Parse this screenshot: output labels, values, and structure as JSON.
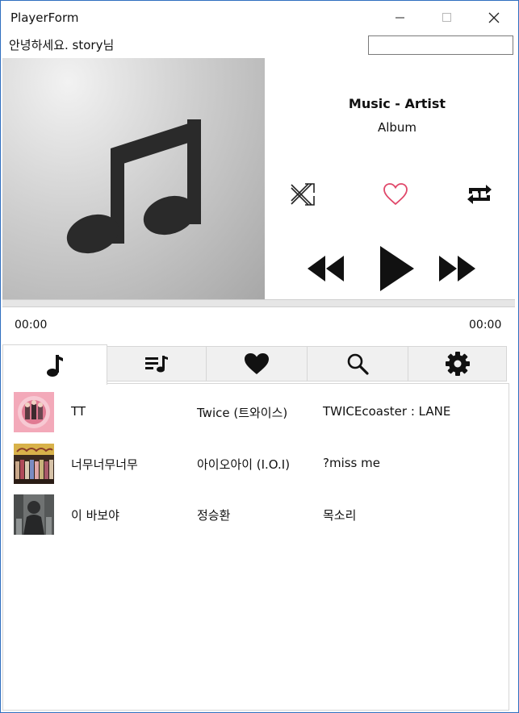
{
  "window": {
    "title": "PlayerForm"
  },
  "header": {
    "greeting": "안녕하세요. story님",
    "search_value": ""
  },
  "now_playing": {
    "title": "Music - Artist",
    "album": "Album"
  },
  "player": {
    "time_current": "00:00",
    "time_total": "00:00",
    "progress": 0
  },
  "tabs": [
    {
      "icon": "music-note-icon",
      "active": true
    },
    {
      "icon": "playlist-icon",
      "active": false
    },
    {
      "icon": "heart-icon",
      "active": false
    },
    {
      "icon": "search-icon",
      "active": false
    },
    {
      "icon": "gear-icon",
      "active": false
    }
  ],
  "songs": [
    {
      "title": "TT",
      "artist": "Twice (트와이스)",
      "album": "TWICEcoaster : LANE"
    },
    {
      "title": "너무너무너무",
      "artist": "아이오아이 (I.O.I)",
      "album": "?miss me"
    },
    {
      "title": "이 바보야",
      "artist": "정승환",
      "album": "목소리"
    }
  ],
  "colors": {
    "heart": "#e0486a",
    "accent": "#3c8fe0"
  }
}
